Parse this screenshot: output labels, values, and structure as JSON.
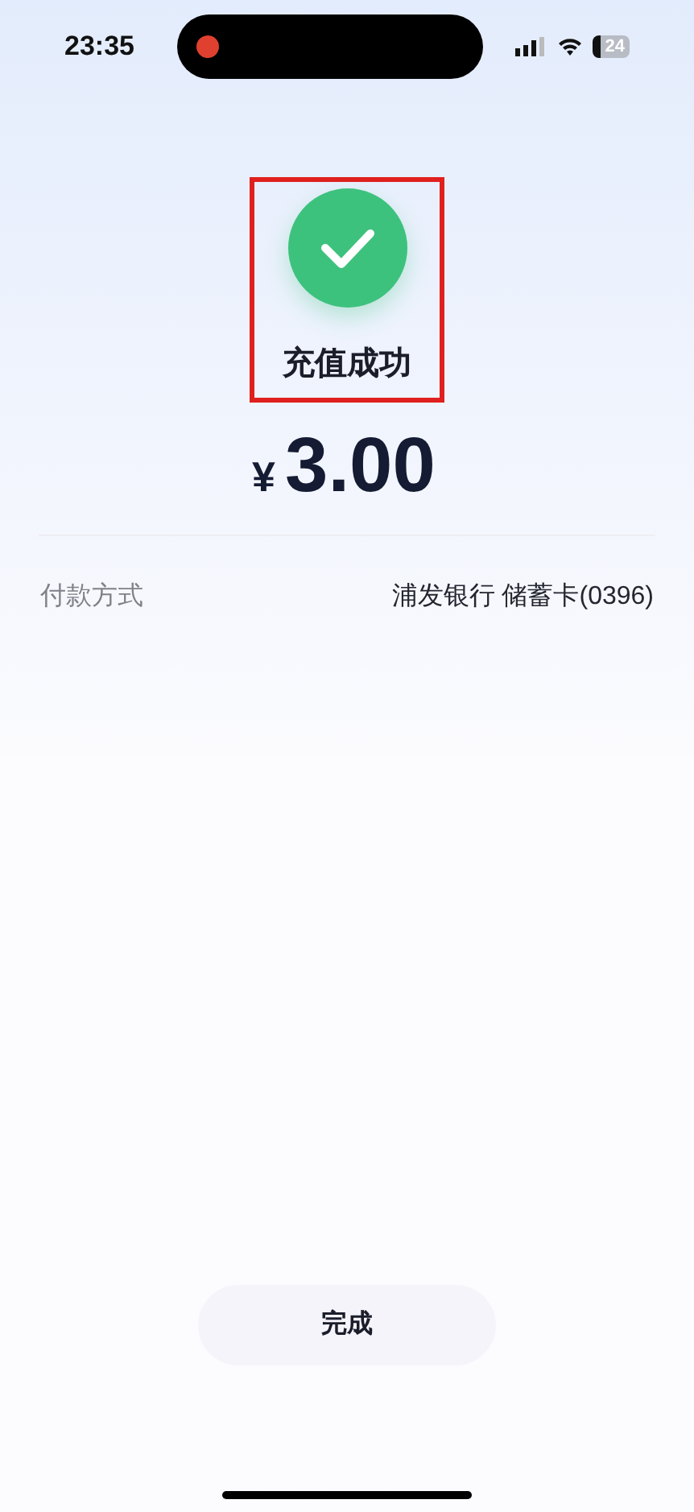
{
  "status_bar": {
    "time": "23:35",
    "recording": true,
    "battery": "24"
  },
  "result": {
    "title": "充值成功",
    "highlighted": true,
    "currency": "¥",
    "amount": "3.00"
  },
  "details": [
    {
      "label": "付款方式",
      "value": "浦发银行 储蓄卡(0396)"
    }
  ],
  "done_button": {
    "label": "完成"
  }
}
